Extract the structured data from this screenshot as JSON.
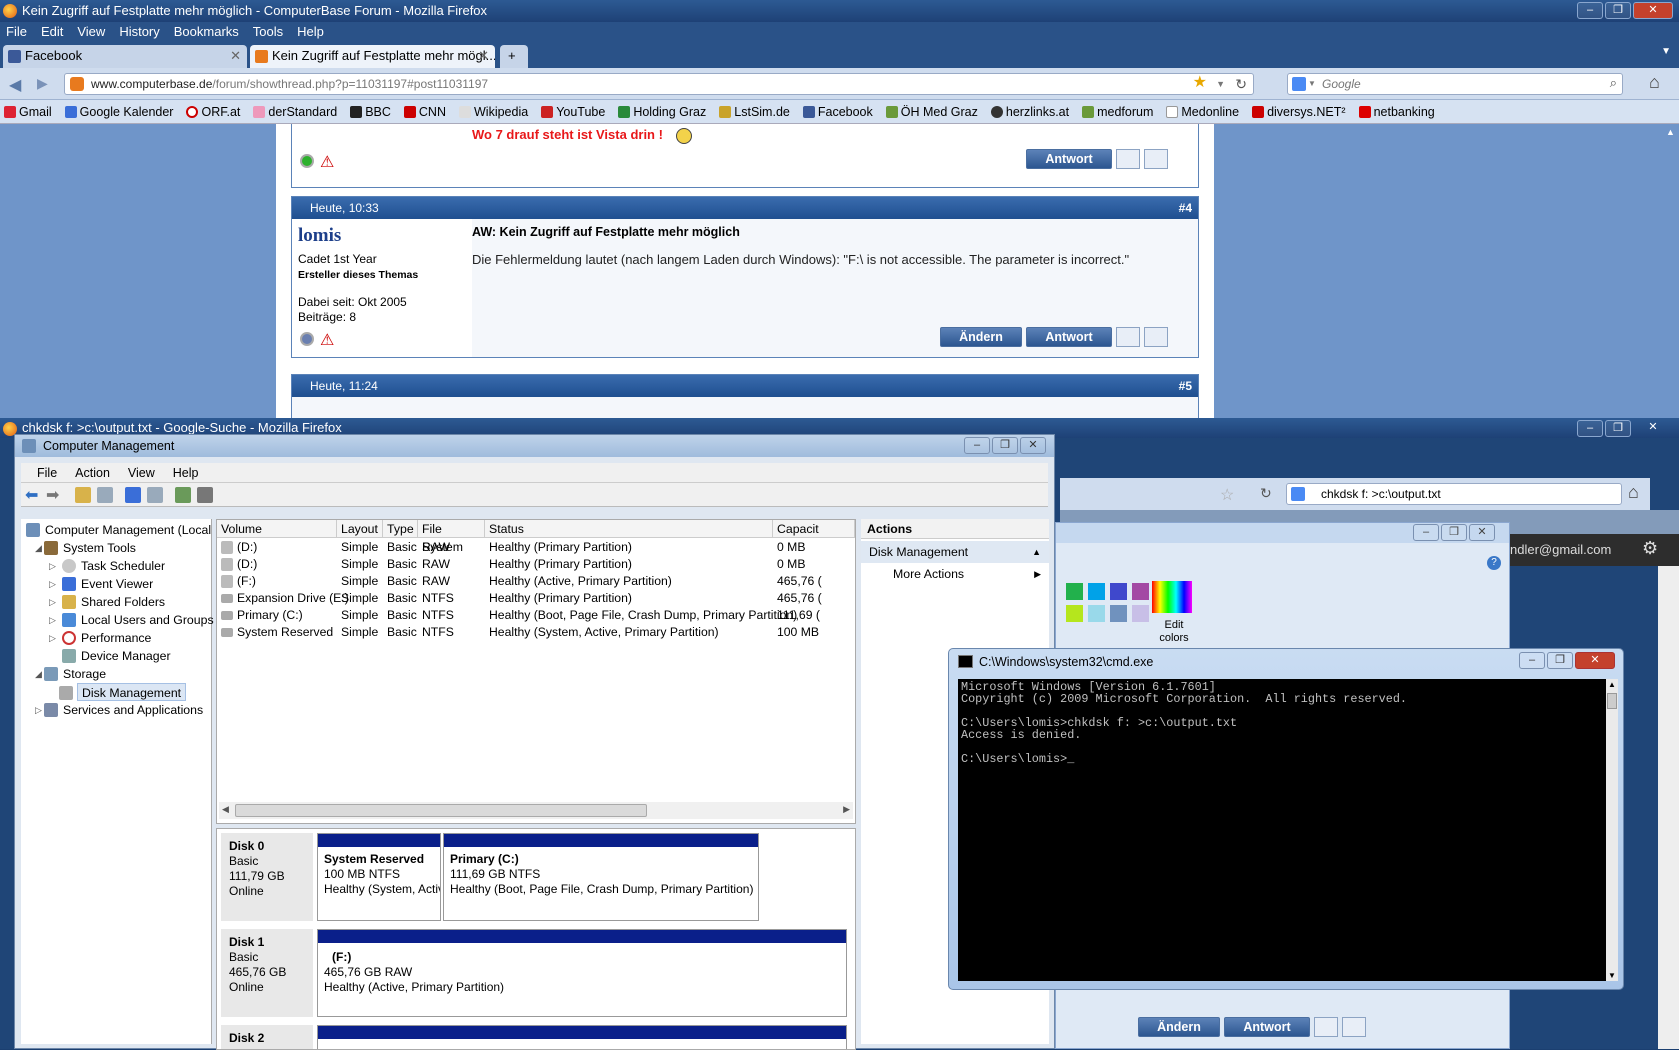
{
  "browser_top": {
    "title": "Kein Zugriff auf Festplatte mehr möglich - ComputerBase Forum - Mozilla Firefox",
    "menu": [
      "File",
      "Edit",
      "View",
      "History",
      "Bookmarks",
      "Tools",
      "Help"
    ],
    "tabs": [
      {
        "label": "Facebook"
      },
      {
        "label": "Kein Zugriff auf Festplatte mehr mögl..."
      }
    ],
    "url_domain": "www.computerbase.de",
    "url_rest": "/forum/showthread.php?p=11031197#post11031197",
    "search_placeholder": "Google",
    "bookmarks": [
      "Gmail",
      "Google Kalender",
      "ORF.at",
      "derStandard",
      "BBC",
      "CNN",
      "Wikipedia",
      "YouTube",
      "Holding Graz",
      "LstSim.de",
      "Facebook",
      "ÖH Med Graz",
      "herzlinks.at",
      "medforum",
      "Medonline",
      "diversys.NET²",
      "netbanking"
    ]
  },
  "forum": {
    "prev_post_text": "Wo 7 drauf steht ist Vista drin !",
    "reply_label": "Antwort",
    "edit_label": "Ändern",
    "post4": {
      "date": "Heute, 10:33",
      "number": "#4",
      "author": "lomis",
      "rank": "Cadet 1st Year",
      "role": "Ersteller dieses Themas",
      "joined": "Dabei seit: Okt 2005",
      "posts": "Beiträge: 8",
      "subject": "AW: Kein Zugriff auf Festplatte mehr möglich",
      "body": "Die Fehlermeldung lautet (nach langem Laden durch Windows): \"F:\\ is not accessible. The parameter is incorrect.\""
    },
    "post5": {
      "date": "Heute, 11:24",
      "number": "#5"
    }
  },
  "browser_bottom": {
    "title": "chkdsk f: >c:\\output.txt - Google-Suche - Mozilla Firefox",
    "search_value": "chkdsk f: >c:\\output.txt",
    "account": "ndler@gmail.com"
  },
  "computer_management": {
    "title": "Computer Management",
    "menu": [
      "File",
      "Action",
      "View",
      "Help"
    ],
    "tree": {
      "root": "Computer Management (Local",
      "system_tools": "System Tools",
      "task_scheduler": "Task Scheduler",
      "event_viewer": "Event Viewer",
      "shared_folders": "Shared Folders",
      "local_users": "Local Users and Groups",
      "performance": "Performance",
      "device_manager": "Device Manager",
      "storage": "Storage",
      "disk_management": "Disk Management",
      "services": "Services and Applications"
    },
    "columns": [
      "Volume",
      "Layout",
      "Type",
      "File System",
      "Status",
      "Capacit"
    ],
    "volumes": [
      [
        "(D:)",
        "Simple",
        "Basic",
        "RAW",
        "Healthy (Primary Partition)",
        "0 MB"
      ],
      [
        "(D:)",
        "Simple",
        "Basic",
        "RAW",
        "Healthy (Primary Partition)",
        "0 MB"
      ],
      [
        "(F:)",
        "Simple",
        "Basic",
        "RAW",
        "Healthy (Active, Primary Partition)",
        "465,76 ("
      ],
      [
        "Expansion Drive (E:)",
        "Simple",
        "Basic",
        "NTFS",
        "Healthy (Primary Partition)",
        "465,76 ("
      ],
      [
        "Primary (C:)",
        "Simple",
        "Basic",
        "NTFS",
        "Healthy (Boot, Page File, Crash Dump, Primary Partition)",
        "111,69 ("
      ],
      [
        "System Reserved",
        "Simple",
        "Basic",
        "NTFS",
        "Healthy (System, Active, Primary Partition)",
        "100 MB"
      ]
    ],
    "actions_header": "Actions",
    "actions_section": "Disk Management",
    "more_actions": "More Actions",
    "disk0": {
      "name": "Disk 0",
      "type": "Basic",
      "size": "111,79 GB",
      "state": "Online",
      "p1_name": "System Reserved",
      "p1_size": "100 MB NTFS",
      "p1_status": "Healthy (System, Activ",
      "p2_name": "Primary  (C:)",
      "p2_size": "111,69 GB NTFS",
      "p2_status": "Healthy (Boot, Page File, Crash Dump, Primary Partition)"
    },
    "disk1": {
      "name": "Disk 1",
      "type": "Basic",
      "size": "465,76 GB",
      "state": "Online",
      "p1_name": "(F:)",
      "p1_size": "465,76 GB RAW",
      "p1_status": "Healthy (Active, Primary Partition)"
    },
    "disk2": {
      "name": "Disk 2"
    }
  },
  "paint": {
    "edit_colors_1": "Edit",
    "edit_colors_2": "colors"
  },
  "cmd": {
    "title": "C:\\Windows\\system32\\cmd.exe",
    "output": "Microsoft Windows [Version 6.1.7601]\nCopyright (c) 2009 Microsoft Corporation.  All rights reserved.\n\nC:\\Users\\lomis>chkdsk f: >c:\\output.txt\nAccess is denied.\n\nC:\\Users\\lomis>_"
  }
}
